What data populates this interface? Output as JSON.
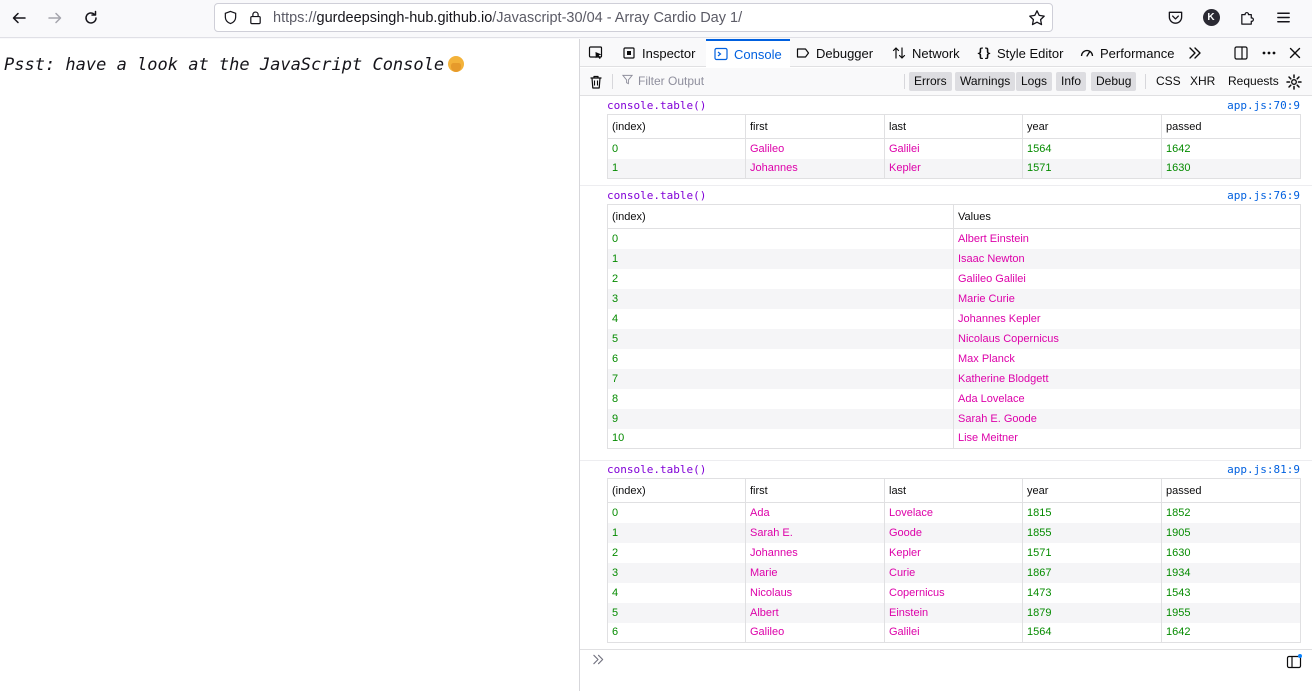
{
  "browser": {
    "url_prefix": "https://",
    "url_host": "gurdeepsingh-hub.github.io",
    "url_path": "/Javascript-30/04 - Array Cardio Day 1/",
    "avatar_letter": "K",
    "icons": [
      "back-arrow-icon",
      "forward-arrow-icon",
      "reload-icon",
      "shield-icon",
      "lock-icon",
      "star-icon",
      "pocket-icon",
      "extensions-icon",
      "menu-icon"
    ]
  },
  "page": {
    "psst_text": "Psst: have a look at the JavaScript Console"
  },
  "devtools": {
    "tabs": [
      {
        "label": "Inspector",
        "icon": "inspector-icon"
      },
      {
        "label": "Console",
        "icon": "console-icon"
      },
      {
        "label": "Debugger",
        "icon": "debugger-icon"
      },
      {
        "label": "Network",
        "icon": "network-icon"
      },
      {
        "label": "Style Editor",
        "icon": "style-editor-icon"
      },
      {
        "label": "Performance",
        "icon": "performance-icon"
      }
    ],
    "active_tab": "Console",
    "filter_placeholder": "Filter Output",
    "levels": [
      "Errors",
      "Warnings",
      "Logs",
      "Info",
      "Debug"
    ],
    "types": [
      "CSS",
      "XHR",
      "Requests"
    ],
    "colors": {
      "number": "#058b00",
      "string": "#dd00a9",
      "accent": "#0060df",
      "method": "#8000d7"
    }
  },
  "console": {
    "messages": [
      {
        "head": "console.table()",
        "source": "app.js:70:9",
        "columns": [
          "(index)",
          "first",
          "last",
          "year",
          "passed"
        ],
        "rows": [
          [
            "0",
            "Galileo",
            "Galilei",
            "1564",
            "1642"
          ],
          [
            "1",
            "Johannes",
            "Kepler",
            "1571",
            "1630"
          ]
        ]
      },
      {
        "head": "console.table()",
        "source": "app.js:76:9",
        "columns": [
          "(index)",
          "Values"
        ],
        "rows": [
          [
            "0",
            "Albert Einstein"
          ],
          [
            "1",
            "Isaac Newton"
          ],
          [
            "2",
            "Galileo Galilei"
          ],
          [
            "3",
            "Marie Curie"
          ],
          [
            "4",
            "Johannes Kepler"
          ],
          [
            "5",
            "Nicolaus Copernicus"
          ],
          [
            "6",
            "Max Planck"
          ],
          [
            "7",
            "Katherine Blodgett"
          ],
          [
            "8",
            "Ada Lovelace"
          ],
          [
            "9",
            "Sarah E. Goode"
          ],
          [
            "10",
            "Lise Meitner"
          ]
        ]
      },
      {
        "head": "console.table()",
        "source": "app.js:81:9",
        "columns": [
          "(index)",
          "first",
          "last",
          "year",
          "passed"
        ],
        "rows": [
          [
            "0",
            "Ada",
            "Lovelace",
            "1815",
            "1852"
          ],
          [
            "1",
            "Sarah E.",
            "Goode",
            "1855",
            "1905"
          ],
          [
            "2",
            "Johannes",
            "Kepler",
            "1571",
            "1630"
          ],
          [
            "3",
            "Marie",
            "Curie",
            "1867",
            "1934"
          ],
          [
            "4",
            "Nicolaus",
            "Copernicus",
            "1473",
            "1543"
          ],
          [
            "5",
            "Albert",
            "Einstein",
            "1879",
            "1955"
          ],
          [
            "6",
            "Galileo",
            "Galilei",
            "1564",
            "1642"
          ]
        ]
      }
    ]
  }
}
